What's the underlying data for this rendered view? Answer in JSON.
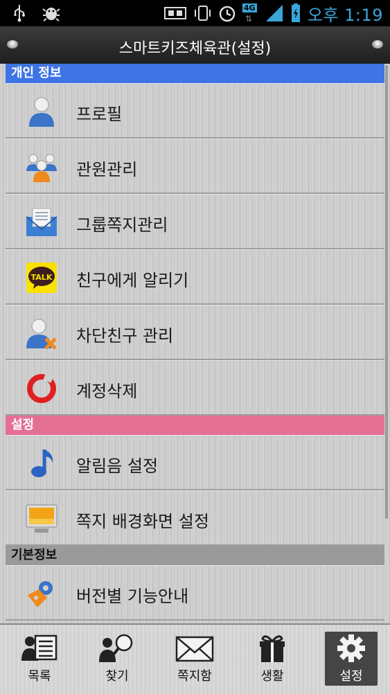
{
  "status_bar": {
    "time": "오후 1:19",
    "network": "4G",
    "icons": [
      "usb-icon",
      "bug-icon",
      "screen-icon",
      "vibrate-icon",
      "alarm-icon",
      "network-4g-icon",
      "signal-icon",
      "battery-icon"
    ]
  },
  "header": {
    "title": "스마트키즈체육관(설정)"
  },
  "sections": [
    {
      "title": "개인 정보",
      "color": "#3f74e4",
      "items": [
        {
          "label": "프로필",
          "icon": "profile-icon"
        },
        {
          "label": "관원관리",
          "icon": "members-icon"
        },
        {
          "label": "그룹쪽지관리",
          "icon": "group-message-icon"
        },
        {
          "label": "친구에게 알리기",
          "icon": "kakaotalk-icon"
        },
        {
          "label": "차단친구 관리",
          "icon": "blocked-friend-icon"
        },
        {
          "label": "계정삭제",
          "icon": "delete-account-icon"
        }
      ]
    },
    {
      "title": "설정",
      "color": "#e56f94",
      "items": [
        {
          "label": "알림음 설정",
          "icon": "music-note-icon"
        },
        {
          "label": "쪽지 배경화면 설정",
          "icon": "monitor-icon"
        }
      ]
    },
    {
      "title": "기본정보",
      "color": "#9a9a9a",
      "items": [
        {
          "label": "버전별 기능안내",
          "icon": "gear-puzzle-icon"
        }
      ]
    }
  ],
  "kakao_badge": "TALK",
  "bottom_nav": {
    "tabs": [
      {
        "label": "목록",
        "icon": "list-icon"
      },
      {
        "label": "찾기",
        "icon": "search-person-icon"
      },
      {
        "label": "쪽지함",
        "icon": "envelope-icon"
      },
      {
        "label": "생활",
        "icon": "gift-icon"
      },
      {
        "label": "설정",
        "icon": "gear-icon",
        "active": true
      }
    ]
  }
}
